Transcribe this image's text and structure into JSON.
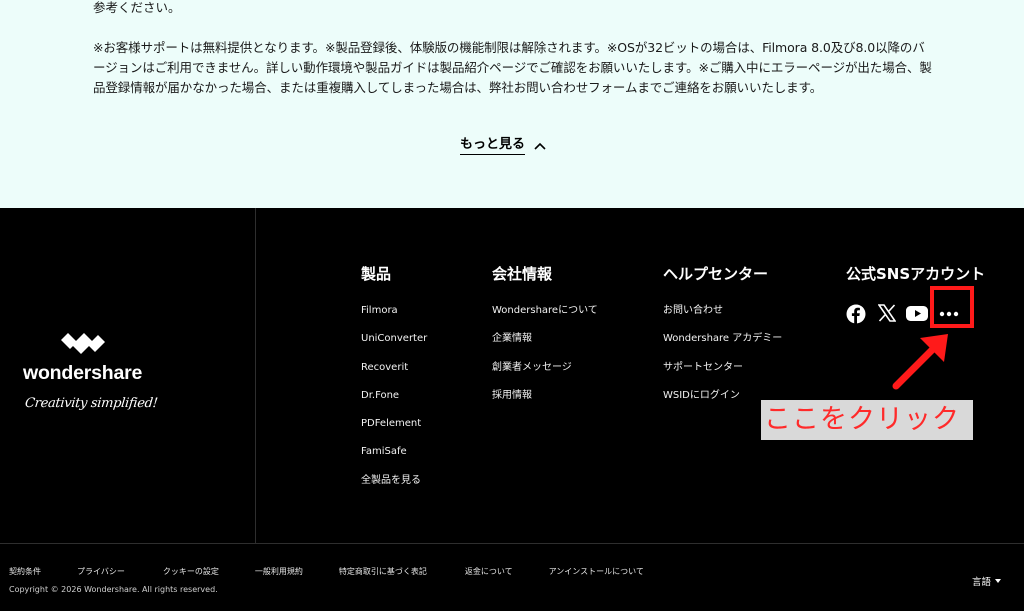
{
  "notice": {
    "line_top": "参考ください。",
    "paragraph": "※お客様サポートは無料提供となります。※製品登録後、体験版の機能制限は解除されます。※OSが32ビットの場合は、Filmora 8.0及び8.0以降のバージョンはご利用できません。詳しい動作環境や製品ガイドは製品紹介ページでご確認をお願いいたします。※ご購入中にエラーページが出た場合、製品登録情報が届かなかった場合、または重複購入してしまった場合は、弊社お問い合わせフォームまでご連絡をお願いいたします。",
    "more_label": "もっと見る"
  },
  "brand": {
    "wordmark": "wondershare",
    "tagline": "Creativity simplified!"
  },
  "footer": {
    "products": {
      "heading": "製品",
      "items": [
        "Filmora",
        "UniConverter",
        "Recoverit",
        "Dr.Fone",
        "PDFelement",
        "FamiSafe",
        "全製品を見る"
      ]
    },
    "company": {
      "heading": "会社情報",
      "items": [
        "Wondershareについて",
        "企業情報",
        "創業者メッセージ",
        "採用情報"
      ]
    },
    "help": {
      "heading": "ヘルプセンター",
      "items": [
        "お問い合わせ",
        "Wondershare アカデミー",
        "サポートセンター",
        "WSIDにログイン"
      ]
    },
    "sns": {
      "heading": "公式SNSアカウント",
      "icons": [
        "facebook-icon",
        "x-icon",
        "youtube-icon",
        "more-dots-icon"
      ]
    },
    "legal_links": [
      "契約条件",
      "プライバシー",
      "クッキーの設定",
      "一般利用規約",
      "特定商取引に基づく表記",
      "返金について",
      "アンインストールについて"
    ],
    "copyright": "Copyright © 2026 Wondershare. All rights reserved.",
    "language_label": "言語"
  },
  "annotation": {
    "callout_text": "ここをクリック",
    "color": "#ff1a1a"
  },
  "colors": {
    "notice_bg": "#edfdfa",
    "footer_bg": "#000000"
  }
}
